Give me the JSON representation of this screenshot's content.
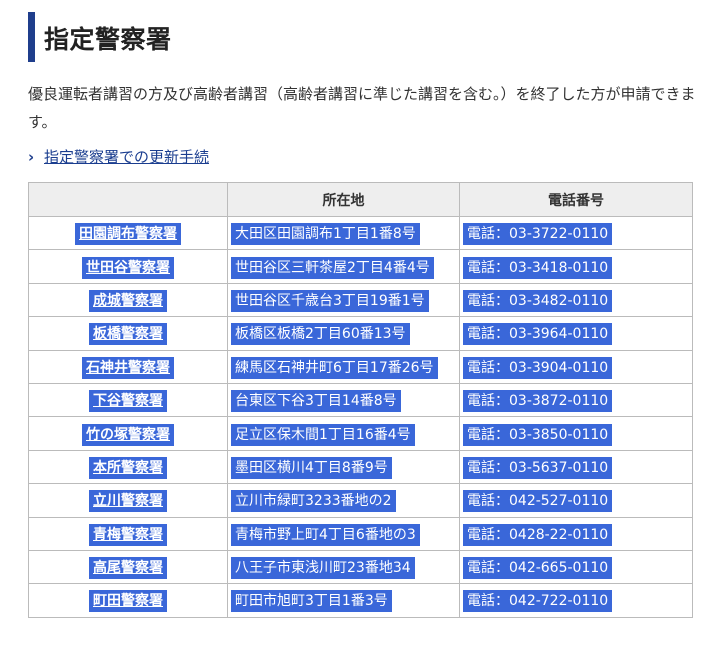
{
  "page": {
    "title": "指定警察署",
    "intro": "優良運転者講習の方及び高齢者講習（高齢者講習に準じた講習を含む。）を終了した方が申請できます。",
    "link_label": "指定警察署での更新手続",
    "link_icon": "chevron-right-icon"
  },
  "table": {
    "headers": [
      "",
      "所在地",
      "電話番号"
    ],
    "rows": [
      {
        "name": "田園調布警察署",
        "address": "大田区田園調布1丁目1番8号",
        "phone": "電話：03-3722-0110"
      },
      {
        "name": "世田谷警察署",
        "address": "世田谷区三軒茶屋2丁目4番4号",
        "phone": "電話：03-3418-0110"
      },
      {
        "name": "成城警察署",
        "address": "世田谷区千歳台3丁目19番1号",
        "phone": "電話：03-3482-0110"
      },
      {
        "name": "板橋警察署",
        "address": "板橋区板橋2丁目60番13号",
        "phone": "電話：03-3964-0110"
      },
      {
        "name": "石神井警察署",
        "address": "練馬区石神井町6丁目17番26号",
        "phone": "電話：03-3904-0110"
      },
      {
        "name": "下谷警察署",
        "address": "台東区下谷3丁目14番8号",
        "phone": "電話：03-3872-0110"
      },
      {
        "name": "竹の塚警察署",
        "address": "足立区保木間1丁目16番4号",
        "phone": "電話：03-3850-0110"
      },
      {
        "name": "本所警察署",
        "address": "墨田区横川4丁目8番9号",
        "phone": "電話：03-5637-0110"
      },
      {
        "name": "立川警察署",
        "address": "立川市緑町3233番地の2",
        "phone": "電話：042-527-0110"
      },
      {
        "name": "青梅警察署",
        "address": "青梅市野上町4丁目6番地の3",
        "phone": "電話：0428-22-0110"
      },
      {
        "name": "高尾警察署",
        "address": "八王子市東浅川町23番地34",
        "phone": "電話：042-665-0110"
      },
      {
        "name": "町田警察署",
        "address": "町田市旭町3丁目1番3号",
        "phone": "電話：042-722-0110"
      }
    ]
  },
  "colors": {
    "heading_bar": "#1f3e8c",
    "selection": "#3a67d9",
    "header_bg": "#eeeeee",
    "link": "#1a3d8f"
  }
}
